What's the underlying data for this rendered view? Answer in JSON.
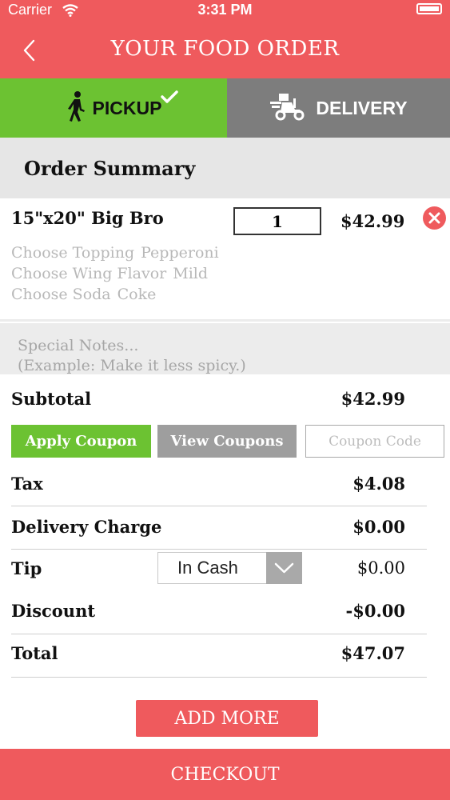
{
  "status_bar": {
    "carrier": "Carrier",
    "time": "3:31 PM"
  },
  "header": {
    "title": "YOUR FOOD ORDER"
  },
  "tabs": [
    {
      "label": "PICKUP",
      "selected": true,
      "color": "#6cc232"
    },
    {
      "label": "DELIVERY",
      "selected": false,
      "color": "#7d7d7d"
    }
  ],
  "summary": {
    "title": "Order Summary"
  },
  "item": {
    "name": "15\"x20\" Big Bro",
    "quantity": "1",
    "price": "$42.99",
    "options": [
      {
        "label": "Choose Topping",
        "value": "Pepperoni"
      },
      {
        "label": "Choose Wing Flavor",
        "value": "Mild"
      },
      {
        "label": "Choose Soda",
        "value": "Coke"
      }
    ]
  },
  "notes": {
    "line1": "Special Notes...",
    "line2": "(Example: Make it less spicy.)"
  },
  "subtotal": {
    "label": "Subtotal",
    "value": "$42.99"
  },
  "coupon": {
    "apply_label": "Apply Coupon",
    "view_label": "View Coupons",
    "placeholder": "Coupon Code"
  },
  "tax": {
    "label": "Tax",
    "value": "$4.08"
  },
  "delivery_charge": {
    "label": "Delivery Charge",
    "value": "$0.00"
  },
  "tip": {
    "label": "Tip",
    "selected": "In Cash",
    "value": "$0.00"
  },
  "discount": {
    "label": "Discount",
    "value": "-$0.00"
  },
  "total": {
    "label": "Total",
    "value": "$47.07"
  },
  "buttons": {
    "add_more": "ADD MORE",
    "checkout": "CHECKOUT"
  },
  "colors": {
    "brand": "#ef5a5d",
    "accent_green": "#6cc232",
    "neutral_gray": "#7d7d7d"
  }
}
